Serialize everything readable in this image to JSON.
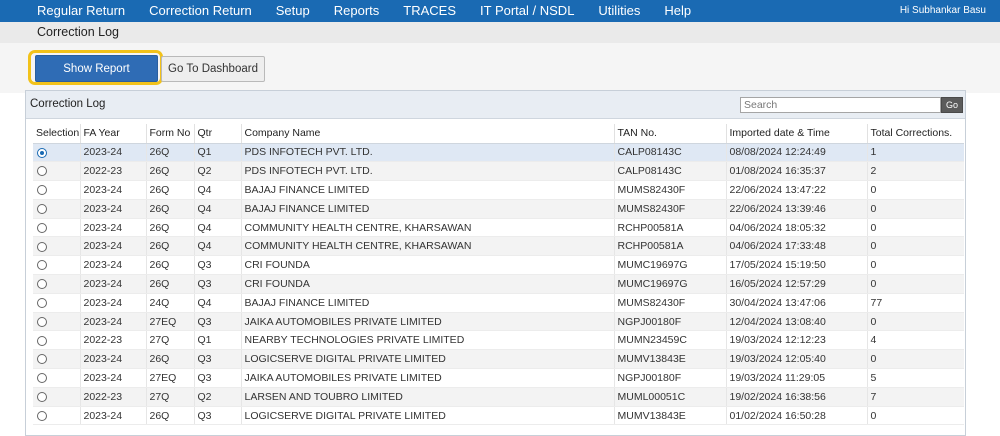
{
  "nav": {
    "items": [
      "Regular Return",
      "Correction Return",
      "Setup",
      "Reports",
      "TRACES",
      "IT Portal / NSDL",
      "Utilities",
      "Help"
    ],
    "user_greeting": "Hi Subhankar Basu"
  },
  "breadcrumb": "Correction Log",
  "actions": {
    "show_report": "Show Report",
    "go_to_dashboard": "Go To Dashboard"
  },
  "panel": {
    "title": "Correction Log",
    "search_placeholder": "Search",
    "go_label": "Go"
  },
  "table": {
    "headers": [
      "Selection",
      "FA Year",
      "Form No",
      "Qtr",
      "Company Name",
      "TAN No.",
      "Imported date & Time",
      "Total Corrections."
    ],
    "selected_index": 0,
    "rows": [
      {
        "fa_year": "2023-24",
        "form_no": "26Q",
        "qtr": "Q1",
        "company": "PDS INFOTECH PVT. LTD.",
        "tan": "CALP08143C",
        "imported": "08/08/2024 12:24:49",
        "total": "1"
      },
      {
        "fa_year": "2022-23",
        "form_no": "26Q",
        "qtr": "Q2",
        "company": "PDS INFOTECH PVT. LTD.",
        "tan": "CALP08143C",
        "imported": "01/08/2024 16:35:37",
        "total": "2"
      },
      {
        "fa_year": "2023-24",
        "form_no": "26Q",
        "qtr": "Q4",
        "company": "BAJAJ FINANCE LIMITED",
        "tan": "MUMS82430F",
        "imported": "22/06/2024 13:47:22",
        "total": "0"
      },
      {
        "fa_year": "2023-24",
        "form_no": "26Q",
        "qtr": "Q4",
        "company": "BAJAJ FINANCE LIMITED",
        "tan": "MUMS82430F",
        "imported": "22/06/2024 13:39:46",
        "total": "0"
      },
      {
        "fa_year": "2023-24",
        "form_no": "26Q",
        "qtr": "Q4",
        "company": "COMMUNITY HEALTH CENTRE, KHARSAWAN",
        "tan": "RCHP00581A",
        "imported": "04/06/2024 18:05:32",
        "total": "0"
      },
      {
        "fa_year": "2023-24",
        "form_no": "26Q",
        "qtr": "Q4",
        "company": "COMMUNITY HEALTH CENTRE, KHARSAWAN",
        "tan": "RCHP00581A",
        "imported": "04/06/2024 17:33:48",
        "total": "0"
      },
      {
        "fa_year": "2023-24",
        "form_no": "26Q",
        "qtr": "Q3",
        "company": "CRI FOUNDA",
        "tan": "MUMC19697G",
        "imported": "17/05/2024 15:19:50",
        "total": "0"
      },
      {
        "fa_year": "2023-24",
        "form_no": "26Q",
        "qtr": "Q3",
        "company": "CRI FOUNDA",
        "tan": "MUMC19697G",
        "imported": "16/05/2024 12:57:29",
        "total": "0"
      },
      {
        "fa_year": "2023-24",
        "form_no": "24Q",
        "qtr": "Q4",
        "company": "BAJAJ FINANCE LIMITED",
        "tan": "MUMS82430F",
        "imported": "30/04/2024 13:47:06",
        "total": "77"
      },
      {
        "fa_year": "2023-24",
        "form_no": "27EQ",
        "qtr": "Q3",
        "company": "JAIKA AUTOMOBILES PRIVATE LIMITED",
        "tan": "NGPJ00180F",
        "imported": "12/04/2024 13:08:40",
        "total": "0"
      },
      {
        "fa_year": "2022-23",
        "form_no": "27Q",
        "qtr": "Q1",
        "company": "NEARBY TECHNOLOGIES PRIVATE LIMITED",
        "tan": "MUMN23459C",
        "imported": "19/03/2024 12:12:23",
        "total": "4"
      },
      {
        "fa_year": "2023-24",
        "form_no": "26Q",
        "qtr": "Q3",
        "company": "LOGICSERVE DIGITAL PRIVATE LIMITED",
        "tan": "MUMV13843E",
        "imported": "19/03/2024 12:05:40",
        "total": "0"
      },
      {
        "fa_year": "2023-24",
        "form_no": "27EQ",
        "qtr": "Q3",
        "company": "JAIKA AUTOMOBILES PRIVATE LIMITED",
        "tan": "NGPJ00180F",
        "imported": "19/03/2024 11:29:05",
        "total": "5"
      },
      {
        "fa_year": "2022-23",
        "form_no": "27Q",
        "qtr": "Q2",
        "company": "LARSEN AND TOUBRO LIMITED",
        "tan": "MUML00051C",
        "imported": "19/02/2024 16:38:56",
        "total": "7"
      },
      {
        "fa_year": "2023-24",
        "form_no": "26Q",
        "qtr": "Q3",
        "company": "LOGICSERVE DIGITAL PRIVATE LIMITED",
        "tan": "MUMV13843E",
        "imported": "01/02/2024 16:50:28",
        "total": "0"
      }
    ]
  }
}
